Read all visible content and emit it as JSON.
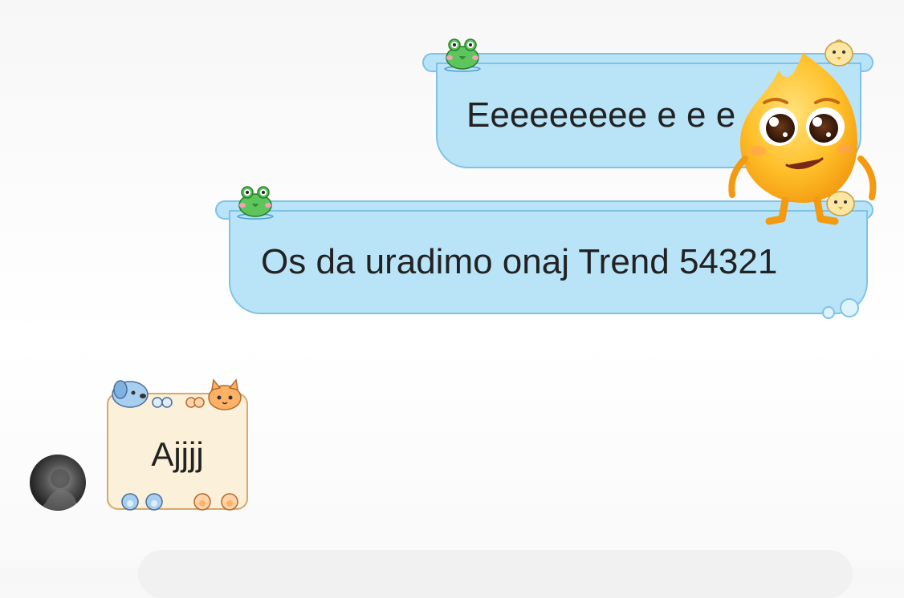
{
  "messages": {
    "outgoing": [
      {
        "text": "Eeeeeeeee e e e"
      },
      {
        "text": "Os da uradimo onaj Trend 54321"
      }
    ],
    "incoming": [
      {
        "text": "Ajjjj"
      }
    ]
  },
  "colors": {
    "out_bubble_fill": "#b9e3f7",
    "out_bubble_border": "#7ec3e6",
    "in_card_fill": "#fbf0d9",
    "in_card_border": "#d8a86c"
  },
  "icons": {
    "frog": "frog-sticker-icon",
    "chick": "chick-sticker-icon",
    "mascot": "flame-mascot-sticker",
    "dog": "dog-sticker-icon",
    "cat": "cat-sticker-icon",
    "paw": "paw-icon"
  }
}
